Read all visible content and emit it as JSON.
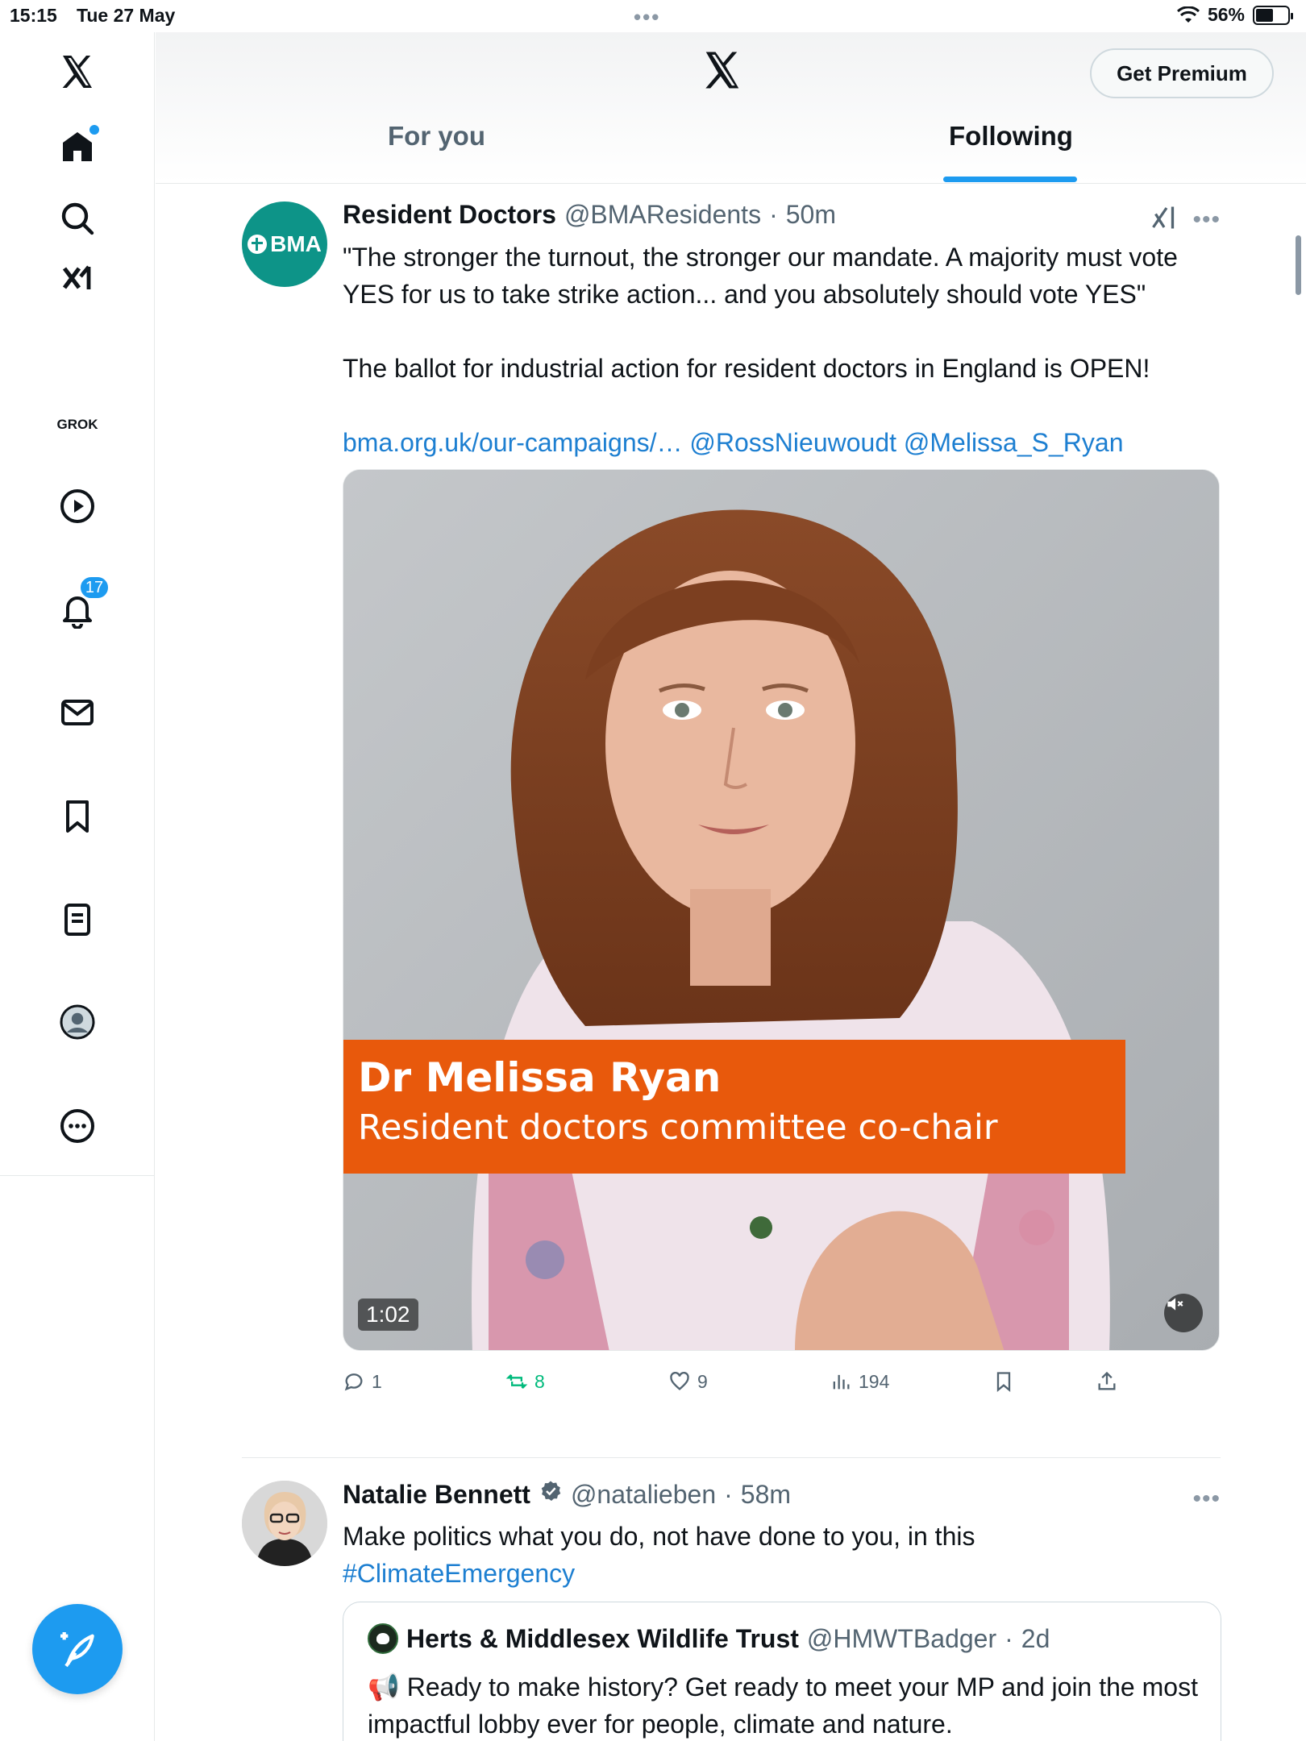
{
  "status_bar": {
    "time": "15:15",
    "date": "Tue 27 May",
    "battery": "56%",
    "battery_level": 0.56
  },
  "sidebar": {
    "items": [
      {
        "name": "home",
        "label": "Home"
      },
      {
        "name": "search",
        "label": "Explore"
      },
      {
        "name": "grok",
        "label": "GROK"
      },
      {
        "name": "video",
        "label": "Video"
      },
      {
        "name": "notifications",
        "label": "Notifications",
        "badge": "17"
      },
      {
        "name": "messages",
        "label": "Messages"
      },
      {
        "name": "bookmarks",
        "label": "Bookmarks"
      },
      {
        "name": "lists",
        "label": "Lists"
      },
      {
        "name": "profile",
        "label": "Profile"
      },
      {
        "name": "more",
        "label": "More"
      }
    ]
  },
  "header": {
    "premium_label": "Get Premium",
    "tabs": [
      {
        "label": "For you",
        "active": false
      },
      {
        "label": "Following",
        "active": true
      }
    ]
  },
  "posts": [
    {
      "author": "Resident Doctors",
      "avatar_text": "BMA",
      "handle": "@BMAResidents",
      "time": "50m",
      "text_lines": [
        "\"The stronger the turnout, the stronger our mandate. A majority must vote YES for us to take strike action... and you absolutely should vote YES\"",
        "The ballot for industrial action for resident doctors in England is OPEN!"
      ],
      "links": {
        "url": "bma.org.uk/our-campaigns/…",
        "mention1": "@RossNieuwoudt",
        "mention2": "@Melissa_S_Ryan"
      },
      "video": {
        "caption_name": "Dr Melissa Ryan",
        "caption_role": "Resident doctors committee co-chair",
        "duration": "1:02"
      },
      "stats": {
        "replies": "1",
        "reposts": "8",
        "likes": "9",
        "views": "194"
      }
    },
    {
      "author": "Natalie Bennett",
      "handle": "@natalieben",
      "time": "58m",
      "text": "Make politics what you do, not have done to you, in this",
      "hashtag": "#ClimateEmergency",
      "quote": {
        "author": "Herts & Middlesex Wildlife Trust",
        "handle": "@HMWTBadger",
        "time": "2d",
        "text": "Ready to make history? Get ready to meet your MP and join the most impactful lobby ever for people, climate and nature."
      }
    }
  ],
  "colors": {
    "accent": "#1d9bf0",
    "repost": "#00ba7c",
    "caption_bg": "#e8590c",
    "bma_teal": "#0d9488"
  }
}
